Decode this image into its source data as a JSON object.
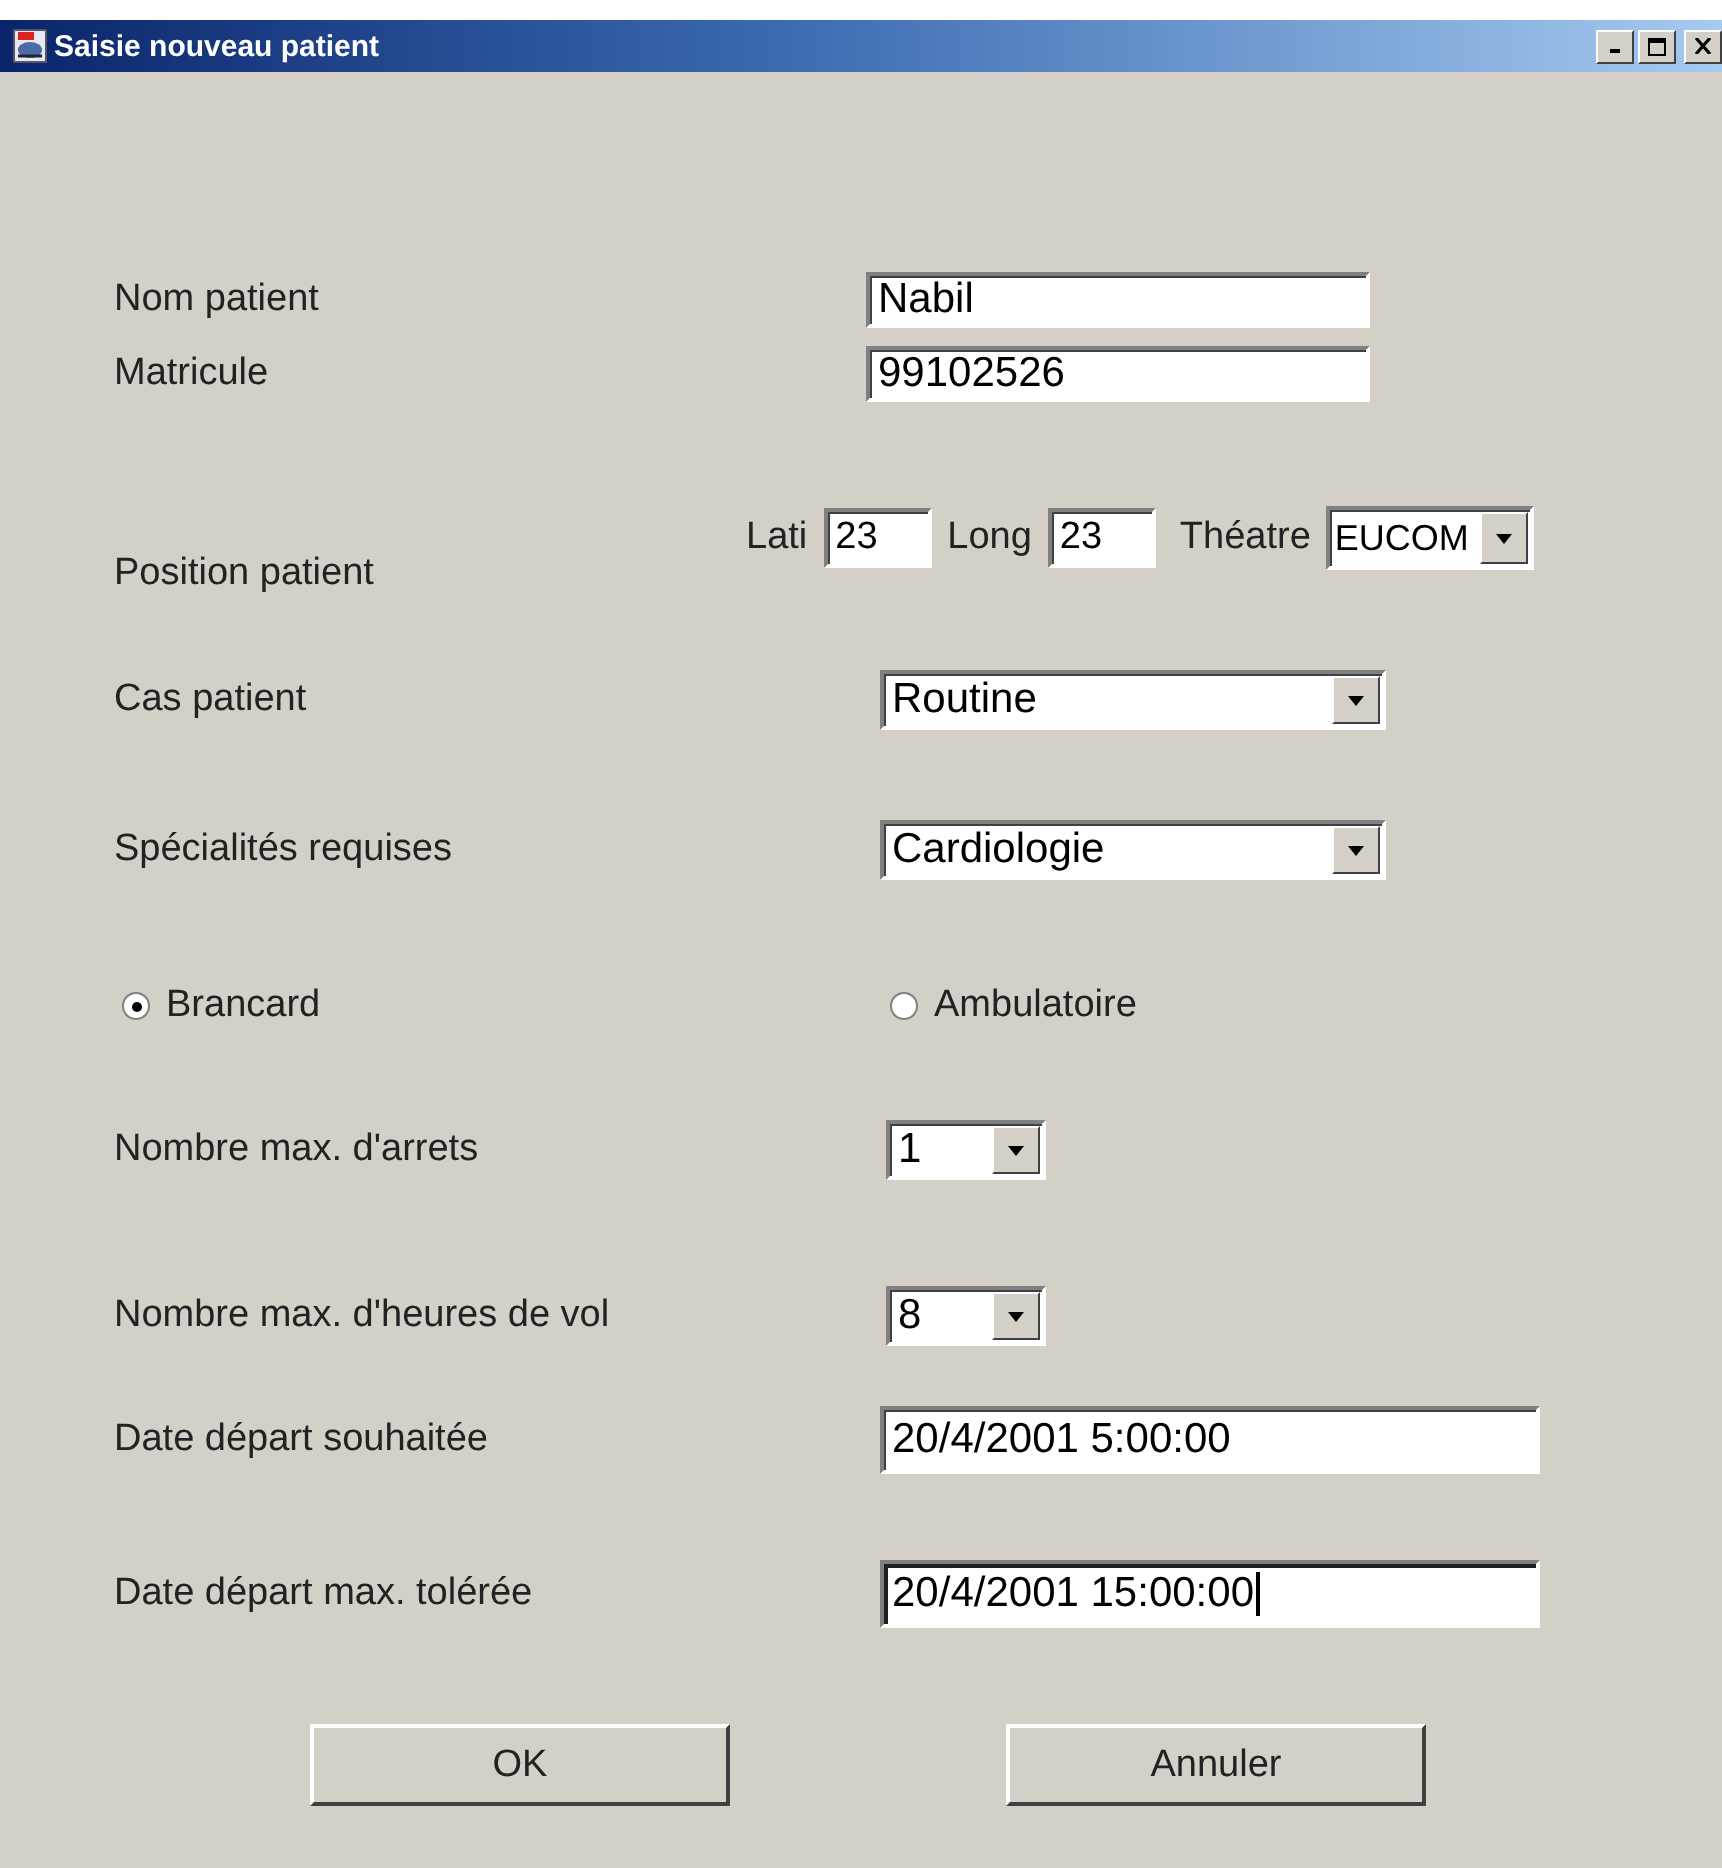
{
  "window": {
    "title": "Saisie nouveau patient"
  },
  "rows": [
    {
      "kind": "text",
      "label": "Nom patient",
      "value": "Nabil",
      "focused": false
    },
    {
      "kind": "text",
      "label": "Matricule",
      "value": "99102526",
      "focused": false
    },
    {
      "kind": "position",
      "label": "Position patient",
      "lat_label": "Lati",
      "lat": "23",
      "long_label": "Long",
      "long": "23",
      "theatre_label": "Théatre",
      "theatre": "EUCOM"
    },
    {
      "kind": "combo",
      "label": "Cas patient",
      "value": "Routine"
    },
    {
      "kind": "combo",
      "label": "Spécialités requises",
      "value": "Cardiologie"
    },
    {
      "kind": "radio",
      "options": [
        {
          "label": "Brancard",
          "selected": true
        },
        {
          "label": "Ambulatoire",
          "selected": false
        }
      ]
    },
    {
      "kind": "small-combo",
      "label": "Nombre max. d'arrets",
      "value": "1"
    },
    {
      "kind": "small-combo",
      "label": "Nombre max. d'heures de vol",
      "value": "8"
    },
    {
      "kind": "date",
      "label": "Date départ souhaitée",
      "value": "20/4/2001 5:00:00",
      "focused": false
    },
    {
      "kind": "date",
      "label": "Date départ max. tolérée",
      "value": "20/4/2001 15:00:00",
      "focused": true
    }
  ],
  "buttons": [
    "OK",
    "Annuler"
  ]
}
